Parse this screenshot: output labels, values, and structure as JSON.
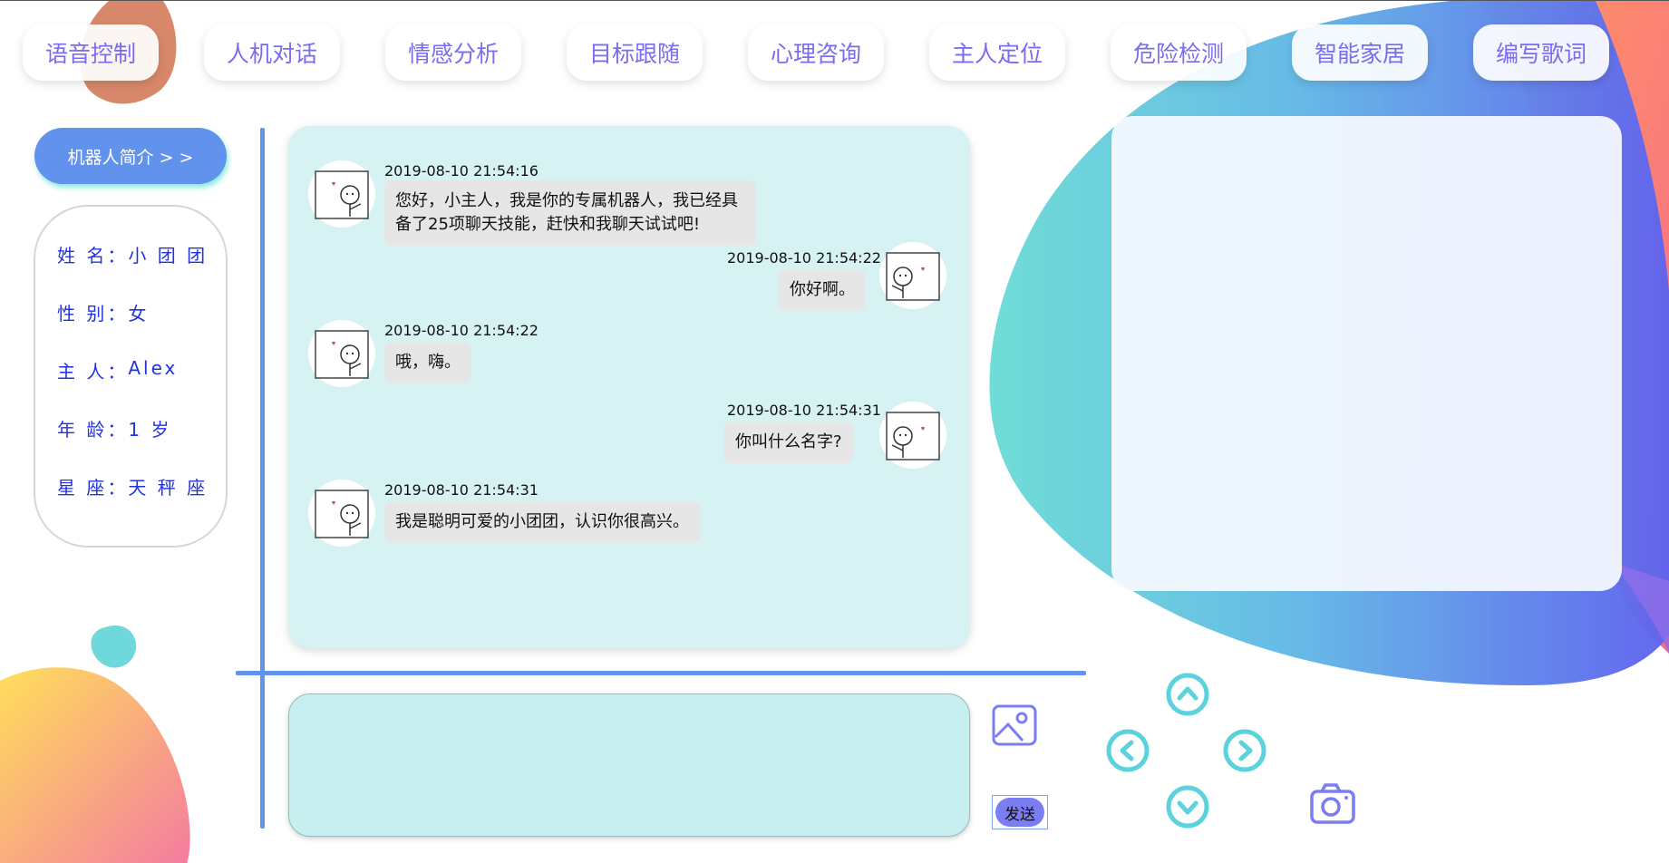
{
  "nav": {
    "items": [
      "语音控制",
      "人机对话",
      "情感分析",
      "目标跟随",
      "心理咨询",
      "主人定位",
      "危险检测",
      "智能家居",
      "编写歌词"
    ]
  },
  "sidebar": {
    "intro_label": "机器人简介 > >",
    "profile": [
      {
        "label": "姓 名：",
        "value": "小 团 团"
      },
      {
        "label": "性 别：",
        "value": "女"
      },
      {
        "label": "主 人：",
        "value": "Alex"
      },
      {
        "label": "年 龄：",
        "value": "1 岁"
      },
      {
        "label": "星 座：",
        "value": "天 秤 座"
      }
    ]
  },
  "chat": {
    "messages": [
      {
        "side": "left",
        "time": "2019-08-10 21:54:16",
        "text": "您好，小主人，我是你的专属机器人，我已经具备了25项聊天技能，赶快和我聊天试试吧!"
      },
      {
        "side": "right",
        "time": "2019-08-10 21:54:22",
        "text": "你好啊。"
      },
      {
        "side": "left",
        "time": "2019-08-10 21:54:22",
        "text": "哦，嗨。"
      },
      {
        "side": "right",
        "time": "2019-08-10 21:54:31",
        "text": "你叫什么名字?"
      },
      {
        "side": "left",
        "time": "2019-08-10 21:54:31",
        "text": "我是聪明可爱的小团团，认识你很高兴。"
      }
    ]
  },
  "composer": {
    "value": "",
    "send_label": "发送"
  },
  "icons": {
    "image": "image-icon",
    "up": "arrow-up-icon",
    "left": "arrow-left-icon",
    "right": "arrow-right-icon",
    "down": "arrow-down-icon",
    "camera": "camera-icon"
  },
  "colors": {
    "accent": "#6293ec",
    "nav_text": "#7a6cf0",
    "chat_bg": "#d6f2f3",
    "input_bg": "#c8efef",
    "profile_text": "#2233dd",
    "control_teal": "#5cd2dc"
  }
}
